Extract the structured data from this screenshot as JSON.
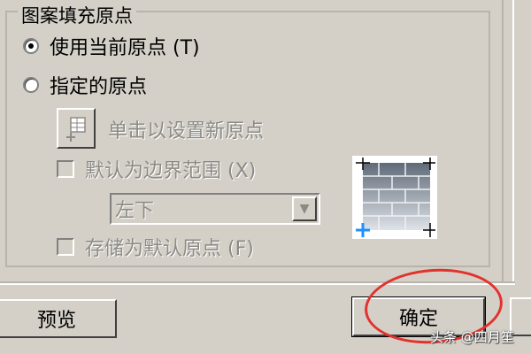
{
  "group": {
    "title": "图案填充原点"
  },
  "options": {
    "use_current": {
      "label": "使用当前原点 (T)",
      "checked": true
    },
    "specified": {
      "label": "指定的原点",
      "checked": false
    }
  },
  "pick_button": {
    "label": "单击以设置新原点",
    "icon": "pick-point-icon"
  },
  "default_boundary": {
    "label": "默认为边界范围 (X)",
    "checked": false
  },
  "position_select": {
    "value": "左下"
  },
  "store_default": {
    "label": "存储为默认原点 (F)",
    "checked": false
  },
  "buttons": {
    "preview": "预览",
    "ok": "确定"
  },
  "watermark": "头条 @四月笙",
  "colors": {
    "highlight_ellipse": "#e3322d",
    "origin_marker": "#1e90ff"
  }
}
